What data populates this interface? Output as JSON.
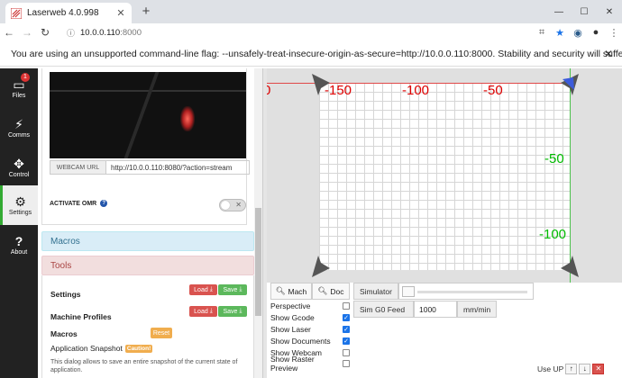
{
  "browser": {
    "tab_title": "Laserweb 4.0.998",
    "new_tab": "+",
    "address_host": "10.0.0.110",
    "address_port": ":8000",
    "infobar_message": "You are using an unsupported command-line flag: --unsafely-treat-insecure-origin-as-secure=http://10.0.0.110:8000. Stability and security will suffer."
  },
  "nav": {
    "items": [
      {
        "label": "Files",
        "badge": "1"
      },
      {
        "label": "Comms"
      },
      {
        "label": "Control"
      },
      {
        "label": "Settings"
      },
      {
        "label": "About"
      }
    ]
  },
  "settings": {
    "webcam_url_label": "WEBCAM URL",
    "webcam_url_value": "http://10.0.0.110:8080/?action=stream",
    "activate_omr_label": "ACTIVATE OMR",
    "macros_header": "Macros",
    "tools_header": "Tools",
    "tools": {
      "settings_label": "Settings",
      "machine_profiles_label": "Machine Profiles",
      "macros_label": "Macros",
      "load_label": "Load",
      "save_label": "Save",
      "reset_label": "Reset",
      "app_snapshot_label": "Application Snapshot",
      "caution_label": "Caution!",
      "description": "This dialog allows to save an entire snapshot of the current state of application."
    }
  },
  "workspace": {
    "x_labels": [
      "0",
      "-150",
      "-100",
      "-50"
    ],
    "y_labels": [
      "-50",
      "-100"
    ],
    "colors": {
      "x_axis": "#e04848",
      "y_axis": "#4cc24c",
      "x_labels": "#d00000",
      "y_labels": "#00bb00"
    }
  },
  "controls": {
    "mach_label": "Mach",
    "doc_label": "Doc",
    "simulator_label": "Simulator",
    "sim_feed_label": "Sim G0 Feed",
    "sim_feed_value": "1000",
    "sim_feed_unit": "mm/min",
    "options": [
      {
        "label": "Perspective",
        "checked": false
      },
      {
        "label": "Show Gcode",
        "checked": true
      },
      {
        "label": "Show Laser",
        "checked": true
      },
      {
        "label": "Show Documents",
        "checked": true
      },
      {
        "label": "Show Webcam",
        "checked": false
      },
      {
        "label": "Show Raster Preview",
        "checked": false
      }
    ],
    "use_up_label": "Use UP"
  }
}
